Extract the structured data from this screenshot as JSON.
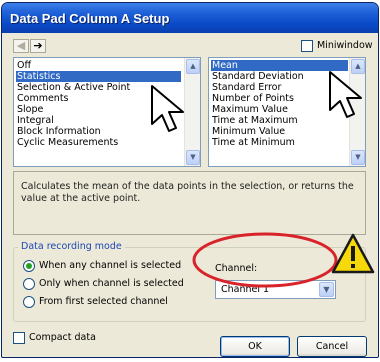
{
  "window": {
    "title": "Data Pad Column A Setup"
  },
  "toolbar": {
    "back_icon": "left-arrow",
    "forward_icon": "right-arrow",
    "miniwindow_label": "Miniwindow",
    "miniwindow_checked": false
  },
  "category_list": {
    "items": [
      "Off",
      "Statistics",
      "Selection & Active Point",
      "Comments",
      "Slope",
      "Integral",
      "Block Information",
      "Cyclic Measurements"
    ],
    "selected": "Statistics"
  },
  "function_list": {
    "items": [
      "Mean",
      "Standard Deviation",
      "Standard Error",
      "Number of Points",
      "Maximum Value",
      "Time at Maximum",
      "Minimum Value",
      "Time at Minimum"
    ],
    "selected": "Mean"
  },
  "description": "Calculates the mean of the data points in the selection, or returns the value at the active point.",
  "recording_mode": {
    "title": "Data recording mode",
    "options": [
      "When any channel is selected",
      "Only when channel is selected",
      "From first selected channel"
    ],
    "selected_index": 0
  },
  "channel": {
    "label": "Channel:",
    "value": "Channel 1"
  },
  "compact_data": {
    "label": "Compact data",
    "checked": false
  },
  "buttons": {
    "ok": "OK",
    "cancel": "Cancel"
  },
  "colors": {
    "titlebar": "#0a4ac8",
    "selection": "#316ac5",
    "annotation_ellipse": "#d9232a",
    "warning_fill": "#f5d90a"
  },
  "icons": {
    "warning": "warning-triangle-icon",
    "pointer": "mouse-pointer-icon"
  }
}
